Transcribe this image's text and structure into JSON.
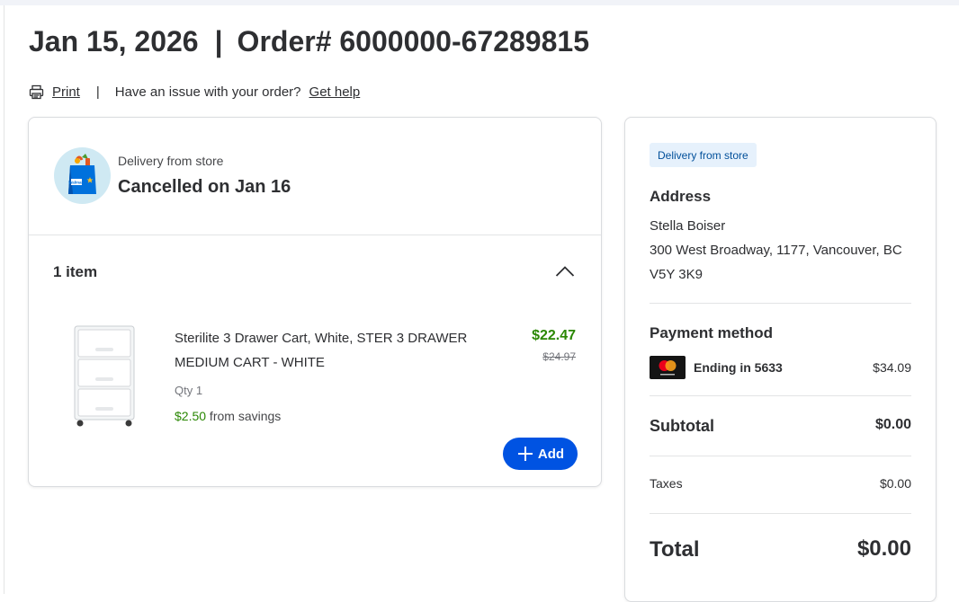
{
  "header": {
    "date": "Jan 15, 2026",
    "separator": "|",
    "order_number": "Order# 6000000-67289815"
  },
  "actions": {
    "print_label": "Print",
    "separator": "|",
    "issue_text": "Have an issue with your order?",
    "help_link": "Get help"
  },
  "delivery": {
    "label": "Delivery from store",
    "status": "Cancelled on Jan 16",
    "item_count": "1 item",
    "store_badge_text": "Walmart"
  },
  "product": {
    "name": "Sterilite 3 Drawer Cart, White, STER 3 DRAWER MEDIUM CART - WHITE",
    "price": "$22.47",
    "original_price": "$24.97",
    "qty": "Qty 1",
    "savings_amount": "$2.50",
    "savings_text": " from savings",
    "add_label": "Add"
  },
  "summary": {
    "badge": "Delivery from store",
    "address_heading": "Address",
    "name": "Stella Boiser",
    "address_line1": "300 West Broadway, 1177, Vancouver, BC",
    "address_line2": "V5Y 3K9",
    "payment_heading": "Payment method",
    "card_ending": "Ending in 5633",
    "payment_amount": "$34.09",
    "subtotal_label": "Subtotal",
    "subtotal_value": "$0.00",
    "taxes_label": "Taxes",
    "taxes_value": "$0.00",
    "total_label": "Total",
    "total_value": "$0.00"
  },
  "colors": {
    "accent_blue": "#0053e2",
    "price_green": "#2a8703",
    "badge_bg": "#e6f1fc",
    "mastercard_red": "#eb001b",
    "mastercard_orange": "#f79e1b"
  },
  "icons": {
    "print": "printer-icon",
    "collapse": "chevron-up-icon",
    "add": "plus-icon",
    "card": "mastercard-icon"
  }
}
